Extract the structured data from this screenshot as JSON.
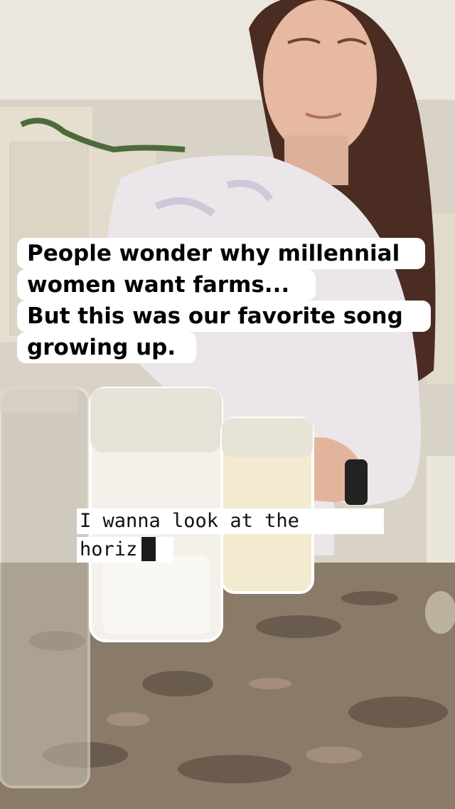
{
  "caption": {
    "lines": [
      "People wonder why millennial",
      "women want farms...",
      "But this was our favorite song",
      "growing up."
    ]
  },
  "lyric": {
    "lines": [
      "I wanna look at the",
      "horiz"
    ]
  },
  "colors": {
    "caption_bg": "#ffffff",
    "caption_text": "#000000",
    "cursor": "#1a1a1a"
  }
}
